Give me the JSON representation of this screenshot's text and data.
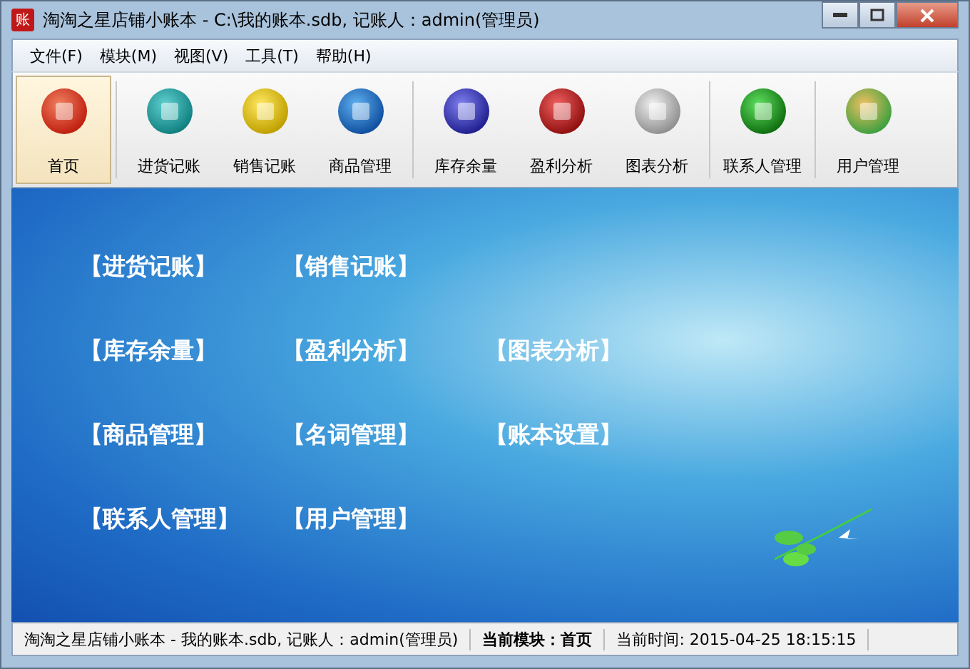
{
  "window": {
    "logo": "账",
    "title": "淘淘之星店铺小账本 - C:\\我的账本.sdb, 记账人：admin(管理员)"
  },
  "menu": [
    "文件(F)",
    "模块(M)",
    "视图(V)",
    "工具(T)",
    "帮助(H)"
  ],
  "toolbar": [
    [
      {
        "label": "首页",
        "selected": true
      }
    ],
    [
      {
        "label": "进货记账",
        "selected": false
      },
      {
        "label": "销售记账",
        "selected": false
      },
      {
        "label": "商品管理",
        "selected": false
      }
    ],
    [
      {
        "label": "库存余量",
        "selected": false
      },
      {
        "label": "盈利分析",
        "selected": false
      },
      {
        "label": "图表分析",
        "selected": false
      }
    ],
    [
      {
        "label": "联系人管理",
        "selected": false
      }
    ],
    [
      {
        "label": "用户管理",
        "selected": false
      }
    ]
  ],
  "links": [
    [
      "【进货记账】",
      "【销售记账】"
    ],
    [
      "【库存余量】",
      "【盈利分析】",
      "【图表分析】"
    ],
    [
      "【商品管理】",
      "【名词管理】",
      "【账本设置】"
    ],
    [
      "【联系人管理】",
      "【用户管理】"
    ]
  ],
  "status_bar": {
    "info": "淘淘之星店铺小账本 - 我的账本.sdb, 记账人：admin(管理员)",
    "module": "当前模块：首页",
    "time": "当前时间: 2015-04-25 18:15:15"
  }
}
